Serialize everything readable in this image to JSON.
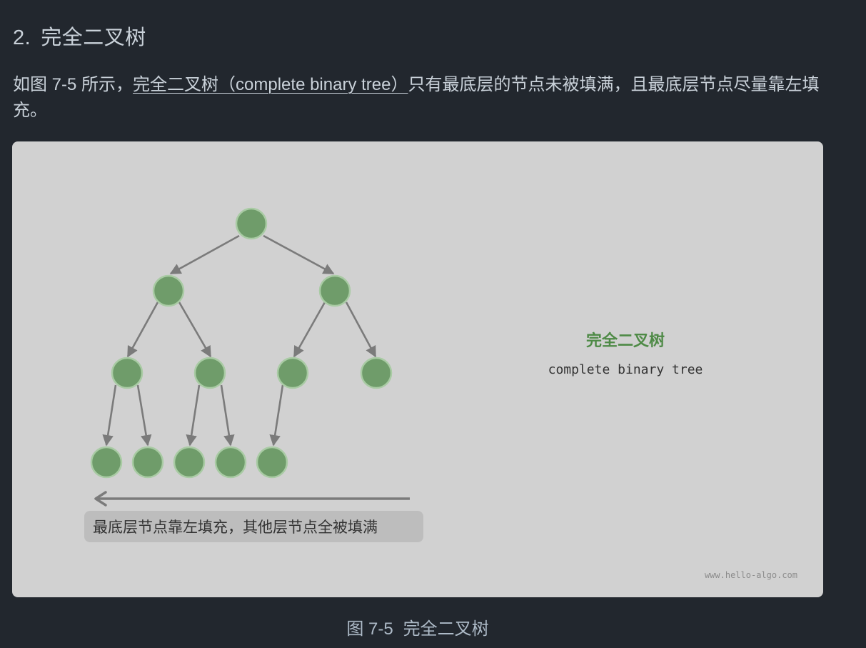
{
  "section": {
    "number": "2.",
    "title": "完全二叉树"
  },
  "paragraph": {
    "before": "如图 7-5 所示，",
    "link": "完全二叉树（complete binary tree）",
    "after": "只有最底层的节点未被填满，且最底层节点尽量靠左填充。"
  },
  "figure": {
    "title": "完全二叉树",
    "subtitle": "complete binary tree",
    "annotation": "最底层节点靠左填充，其他层节点全被填满",
    "watermark": "www.hello-algo.com",
    "colors": {
      "background": "#d1d1d1",
      "node_fill": "#6f9c6a",
      "node_ring": "#a9cba4",
      "edge": "#7b7b7b",
      "title": "#4e8a46",
      "annotation_bg": "#bdbdbd"
    }
  },
  "caption": {
    "number": "图 7-5",
    "title": "完全二叉树"
  }
}
